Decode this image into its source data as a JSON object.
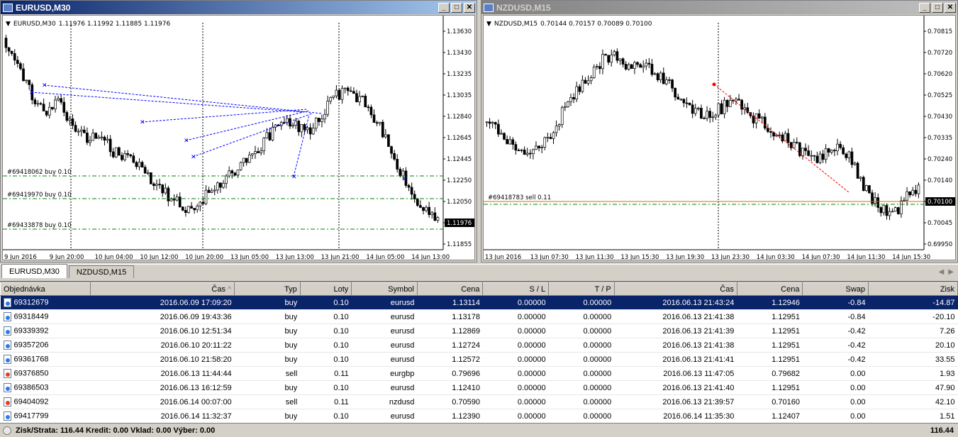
{
  "windows": [
    {
      "title": "EURUSD,M30",
      "header": {
        "symbol": "EURUSD,M30",
        "ohlc": "1.11976 1.11992 1.11885 1.11976"
      },
      "prices": [
        "1.13630",
        "1.13430",
        "1.13235",
        "1.13035",
        "1.12840",
        "1.12645",
        "1.12445",
        "1.12250",
        "1.12050",
        "1.11976",
        "1.11855"
      ],
      "current_price": "1.11976",
      "times": [
        "9 Jun 2016",
        "9 Jun 20:00",
        "10 Jun 04:00",
        "10 Jun 12:00",
        "10 Jun 20:00",
        "13 Jun 05:00",
        "13 Jun 13:00",
        "13 Jun 21:00",
        "14 Jun 05:00",
        "14 Jun 13:00"
      ],
      "order_lines": [
        "#69418062 buy 0.10",
        "#69419970 buy 0.10",
        "#69433878 buy 0.10"
      ]
    },
    {
      "title": "NZDUSD,M15",
      "header": {
        "symbol": "NZDUSD,M15",
        "ohlc": "0.70144 0.70157 0.70089 0.70100"
      },
      "prices": [
        "0.70815",
        "0.70720",
        "0.70620",
        "0.70525",
        "0.70430",
        "0.70335",
        "0.70240",
        "0.70140",
        "0.70100",
        "0.70045",
        "0.69950"
      ],
      "current_price": "0.70100",
      "times": [
        "13 Jun 2016",
        "13 Jun 07:30",
        "13 Jun 11:30",
        "13 Jun 15:30",
        "13 Jun 19:30",
        "13 Jun 23:30",
        "14 Jun 03:30",
        "14 Jun 07:30",
        "14 Jun 11:30",
        "14 Jun 15:30"
      ],
      "order_lines": [
        "#69418783 sell 0.11"
      ]
    }
  ],
  "tabs": [
    "EURUSD,M30",
    "NZDUSD,M15"
  ],
  "columns": [
    "Objednávka",
    "Čas",
    "Typ",
    "Loty",
    "Symbol",
    "Cena",
    "S / L",
    "T / P",
    "Čas",
    "Cena",
    "Swap",
    "Zisk"
  ],
  "orders": [
    {
      "id": "69312679",
      "open_time": "2016.06.09 17:09:20",
      "type": "buy",
      "lots": "0.10",
      "symbol": "eurusd",
      "price": "1.13114",
      "sl": "0.00000",
      "tp": "0.00000",
      "close_time": "2016.06.13 21:43:24",
      "close_price": "1.12946",
      "swap": "-0.84",
      "profit": "-14.87"
    },
    {
      "id": "69318449",
      "open_time": "2016.06.09 19:43:36",
      "type": "buy",
      "lots": "0.10",
      "symbol": "eurusd",
      "price": "1.13178",
      "sl": "0.00000",
      "tp": "0.00000",
      "close_time": "2016.06.13 21:41:38",
      "close_price": "1.12951",
      "swap": "-0.84",
      "profit": "-20.10"
    },
    {
      "id": "69339392",
      "open_time": "2016.06.10 12:51:34",
      "type": "buy",
      "lots": "0.10",
      "symbol": "eurusd",
      "price": "1.12869",
      "sl": "0.00000",
      "tp": "0.00000",
      "close_time": "2016.06.13 21:41:39",
      "close_price": "1.12951",
      "swap": "-0.42",
      "profit": "7.26"
    },
    {
      "id": "69357206",
      "open_time": "2016.06.10 20:11:22",
      "type": "buy",
      "lots": "0.10",
      "symbol": "eurusd",
      "price": "1.12724",
      "sl": "0.00000",
      "tp": "0.00000",
      "close_time": "2016.06.13 21:41:38",
      "close_price": "1.12951",
      "swap": "-0.42",
      "profit": "20.10"
    },
    {
      "id": "69361768",
      "open_time": "2016.06.10 21:58:20",
      "type": "buy",
      "lots": "0.10",
      "symbol": "eurusd",
      "price": "1.12572",
      "sl": "0.00000",
      "tp": "0.00000",
      "close_time": "2016.06.13 21:41:41",
      "close_price": "1.12951",
      "swap": "-0.42",
      "profit": "33.55"
    },
    {
      "id": "69376850",
      "open_time": "2016.06.13 11:44:44",
      "type": "sell",
      "lots": "0.11",
      "symbol": "eurgbp",
      "price": "0.79696",
      "sl": "0.00000",
      "tp": "0.00000",
      "close_time": "2016.06.13 11:47:05",
      "close_price": "0.79682",
      "swap": "0.00",
      "profit": "1.93"
    },
    {
      "id": "69386503",
      "open_time": "2016.06.13 16:12:59",
      "type": "buy",
      "lots": "0.10",
      "symbol": "eurusd",
      "price": "1.12410",
      "sl": "0.00000",
      "tp": "0.00000",
      "close_time": "2016.06.13 21:41:40",
      "close_price": "1.12951",
      "swap": "0.00",
      "profit": "47.90"
    },
    {
      "id": "69404092",
      "open_time": "2016.06.14 00:07:00",
      "type": "sell",
      "lots": "0.11",
      "symbol": "nzdusd",
      "price": "0.70590",
      "sl": "0.00000",
      "tp": "0.00000",
      "close_time": "2016.06.13 21:39:57",
      "close_price": "0.70160",
      "swap": "0.00",
      "profit": "42.10"
    },
    {
      "id": "69417799",
      "open_time": "2016.06.14 11:32:37",
      "type": "buy",
      "lots": "0.10",
      "symbol": "eurusd",
      "price": "1.12390",
      "sl": "0.00000",
      "tp": "0.00000",
      "close_time": "2016.06.14 11:35:30",
      "close_price": "1.12407",
      "swap": "0.00",
      "profit": "1.51"
    }
  ],
  "status": {
    "summary": "Zisk/Strata: 116.44  Kredit: 0.00  Vklad: 0.00  Výber: 0.00",
    "total": "116.44"
  }
}
